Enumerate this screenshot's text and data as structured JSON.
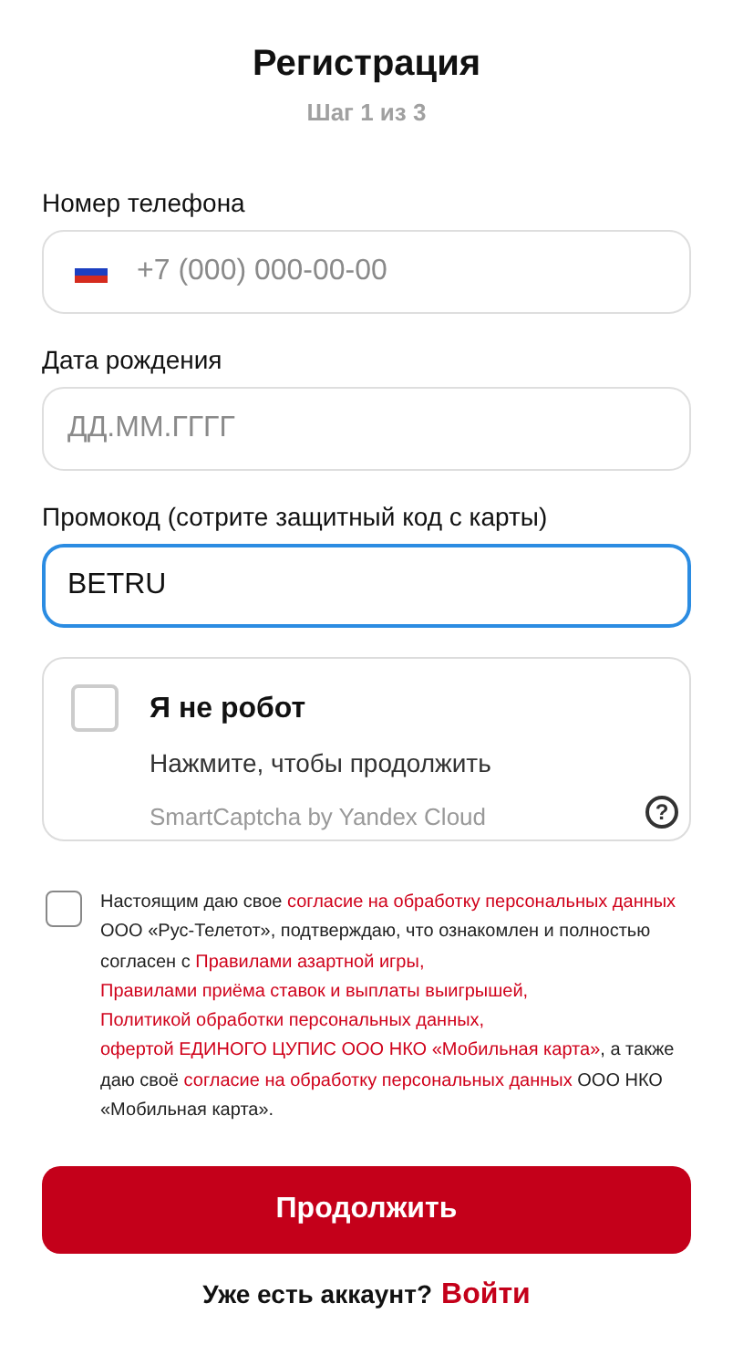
{
  "header": {
    "title": "Регистрация",
    "step": "Шаг 1 из 3"
  },
  "fields": [
    {
      "kind": "phone",
      "label": "Номер телефона",
      "placeholder": "+7 (000) 000-00-00",
      "focused": false
    },
    {
      "kind": "text",
      "label": "Дата рождения",
      "placeholder": "ДД.ММ.ГГГГ",
      "focused": false
    },
    {
      "kind": "text",
      "label": "Промокод (сотрите защитный код с карты)",
      "value": "BETRU",
      "focused": true
    }
  ],
  "captcha": {
    "checked": false,
    "title": "Я не робот",
    "hint": "Нажмите, чтобы продолжить",
    "brand": "SmartCaptcha by Yandex Cloud",
    "help": "?"
  },
  "consent": {
    "checked": false,
    "segments": [
      {
        "kind": "text",
        "text": "Настоящим даю свое "
      },
      {
        "kind": "link",
        "text": "согласие на обработку персональных данных"
      },
      {
        "kind": "text",
        "text": " ООО «Рус-Телетот», подтверждаю, что ознакомлен и полностью согласен с "
      },
      {
        "kind": "link",
        "text": "Правилами азартной игры"
      },
      {
        "kind": "sep",
        "text": ", "
      },
      {
        "kind": "link",
        "text": "Правилами приёма ставок и выплаты выигрышей"
      },
      {
        "kind": "sep",
        "text": ", "
      },
      {
        "kind": "link",
        "text": "Политикой обработки персональных данных"
      },
      {
        "kind": "sep",
        "text": ", "
      },
      {
        "kind": "link",
        "text": "офертой ЕДИНОГО ЦУПИС ООО НКО «Мобильная карта»"
      },
      {
        "kind": "text",
        "text": ", а также даю своё "
      },
      {
        "kind": "link",
        "text": "согласие на обработку персональных данных"
      },
      {
        "kind": "text",
        "text": " ООО НКО «Мобильная карта»."
      }
    ]
  },
  "submit": "Продолжить",
  "footer": {
    "text": "Уже есть аккаунт?",
    "link": "Войти"
  }
}
